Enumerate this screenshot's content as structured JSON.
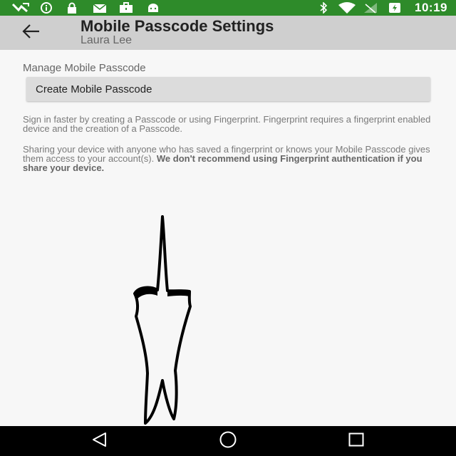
{
  "status_bar": {
    "time": "10:19",
    "left_icons": [
      "missed-call-icon",
      "info-icon",
      "lock-icon",
      "envelope-icon",
      "briefcase-icon",
      "android-icon"
    ],
    "right_icons": [
      "bluetooth-icon",
      "wifi-icon",
      "no-signal-icon",
      "battery-charging-icon"
    ],
    "color": "#2e8b2a"
  },
  "app_bar": {
    "back_icon": "arrow-left-icon",
    "title": "Mobile Passcode Settings",
    "subtitle": "Laura Lee"
  },
  "main": {
    "section_label": "Manage Mobile Passcode",
    "create_button_label": "Create Mobile Passcode",
    "info_1": "Sign in faster by creating a Passcode or using Fingerprint. Fingerprint requires a fingerprint enabled device and the creation of a Passcode.",
    "info_2": "Sharing your device with anyone who has saved a fingerprint or knows your Mobile Passcode gives them access to your account(s).",
    "info_2_bold": "We don't recommend using Fingerprint authentication if you share your device."
  },
  "nav_bar": {
    "icons": [
      "back-triangle-icon",
      "home-circle-icon",
      "recents-square-icon"
    ]
  }
}
